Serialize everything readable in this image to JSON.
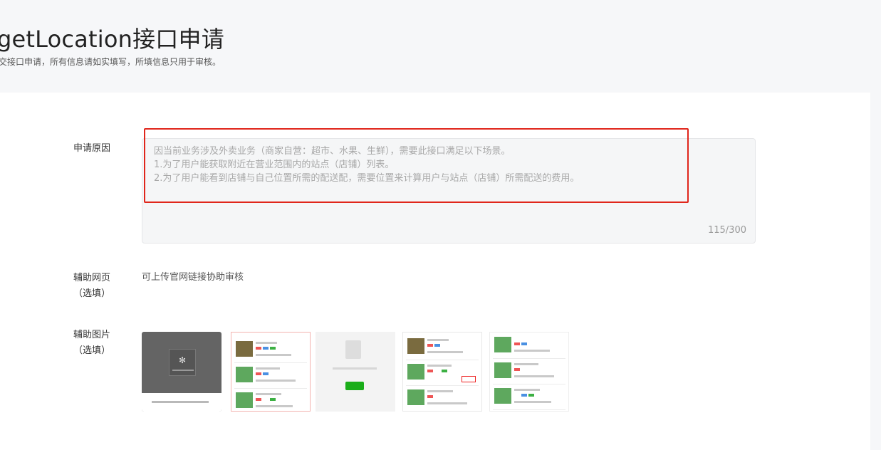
{
  "header": {
    "title": "getLocation接口申请",
    "subtitle": "交接口申请，所有信息请如实填写，所填信息只用于审核。"
  },
  "form": {
    "reason": {
      "label": "申请原因",
      "lines": [
        "因当前业务涉及外卖业务（商家自营：超市、水果、生鲜），需要此接口满足以下场景。",
        "1.为了用户能获取附近在营业范围内的站点（店铺）列表。",
        "2.为了用户能看到店铺与自己位置所需的配送配，需要位置来计算用户与站点（店铺）所需配送的费用。"
      ],
      "counter": "115/300"
    },
    "webpage": {
      "label_line1": "辅助网页",
      "label_line2": "（选填）",
      "helper": "可上传官网链接协助审核"
    },
    "images": {
      "label_line1": "辅助图片",
      "label_line2": "（选填）",
      "thumbnail_count": 5
    }
  },
  "colors": {
    "highlight": "#e0261b",
    "background": "#f6f7f9",
    "card": "#ffffff"
  }
}
